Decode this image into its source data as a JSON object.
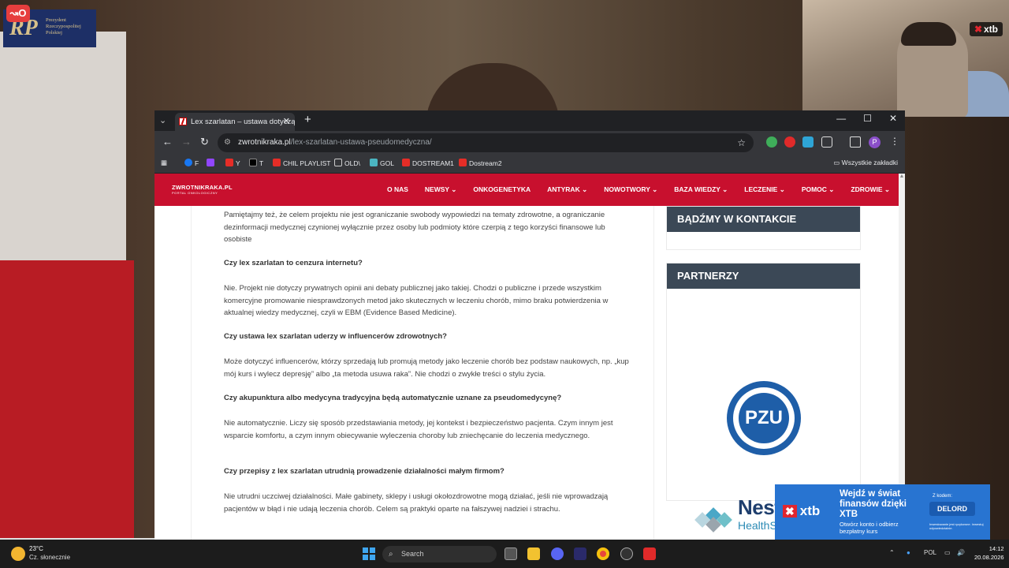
{
  "overlay": {
    "president_logo_text": "Prezydent Rzeczypospolitej Polskiej",
    "president_logo_mark": "RP",
    "stream_key_label": "↝O",
    "webcam_badge": "xtb"
  },
  "browser": {
    "tab_title": "Lex szarlatan – ustawa dotycząca",
    "url_domain": "zwrotnikraka.pl",
    "url_path": "/lex-szarlatan-ustawa-pseudomedyczna/",
    "profile_letter": "P",
    "bookmarks": [
      "F",
      "Y",
      "T",
      "CHIL PLAYLIST",
      "OLD\\",
      "GOL",
      "DOSTREAM1",
      "Dostream2"
    ],
    "all_bookmarks": "Wszystkie zakładki"
  },
  "site": {
    "logo": "ZWROTNIKRAKA.PL",
    "logo_sub": "PORTAL ONKOLOGICZNY",
    "menu": [
      "O NAS",
      "NEWSY ⌄",
      "ONKOGENETYKA",
      "ANTYRAK ⌄",
      "NOWOTWORY ⌄",
      "BAZA WIEDZY ⌄",
      "LECZENIE ⌄",
      "POMOC ⌄",
      "ZDROWIE ⌄"
    ],
    "article": {
      "p0": "Pamiętajmy też, że celem projektu nie jest ograniczanie swobody wypowiedzi na tematy zdrowotne, a ograniczanie dezinformacji medycznej czynionej wyłącznie przez osoby lub podmioty które czerpią z tego korzyści finansowe lub osobiste",
      "q1": "Czy lex szarlatan to cenzura internetu?",
      "a1": "Nie. Projekt nie dotyczy prywatnych opinii ani debaty publicznej jako takiej. Chodzi o publiczne i przede wszystkim komercyjne promowanie niesprawdzonych metod jako skutecznych w leczeniu chorób, mimo braku potwierdzenia w aktualnej wiedzy medycznej, czyli w EBM (Evidence Based Medicine).",
      "q2": "Czy ustawa lex szarlatan uderzy w influencerów zdrowotnych?",
      "a2": "Może dotyczyć influencerów, którzy sprzedają lub promują metody jako leczenie chorób bez podstaw naukowych, np. „kup mój kurs i wylecz depresję” albo „ta metoda usuwa raka”. Nie chodzi o zwykłe treści o stylu życia.",
      "q3": "Czy akupunktura albo medycyna tradycyjna będą automatycznie uznane za pseudomedycynę?",
      "a3": "Nie automatycznie. Liczy się sposób przedstawiania metody, jej kontekst i bezpieczeństwo pacjenta. Czym innym jest wsparcie komfortu, a czym innym obiecywanie wyleczenia choroby lub zniechęcanie do leczenia medycznego.",
      "q4": "Czy przepisy z lex szarlatan utrudnią prowadzenie działalności małym firmom?",
      "a4": "Nie utrudni uczciwej działalności. Małe gabinety, sklepy i usługi okołozdrowotne mogą działać, jeśli nie wprowadzają pacjentów w błąd i nie udają leczenia chorób. Celem są praktyki oparte na fałszywej nadziei i strachu."
    },
    "sidebar": {
      "contact_title": "BĄDŹMY W KONTAKCIE",
      "partners_title": "PARTNERZY",
      "pzu": "PZU",
      "nestle": "Nestlé",
      "nestle_sub": "HealthScience"
    }
  },
  "ad": {
    "brand": "xtb",
    "headline": "Wejdź w świat finansów dzięki XTB",
    "sub": "Otwórz konto i odbierz bezpłatny kurs",
    "code_label": "Z kodem:",
    "code": "DELORD",
    "fine": "Inwestowanie jest ryzykowne. Inwestuj odpowiedzialnie."
  },
  "taskbar": {
    "temp": "23°C",
    "weather": "Cz. słonecznie",
    "search": "Search",
    "lang": "POL",
    "time": "14:12",
    "date": "20.08.2026"
  },
  "colors": {
    "site_red": "#c8102e",
    "sidebar_header": "#3b4856",
    "xtb_blue": "#2874d1",
    "xtb_red": "#e0262f"
  }
}
